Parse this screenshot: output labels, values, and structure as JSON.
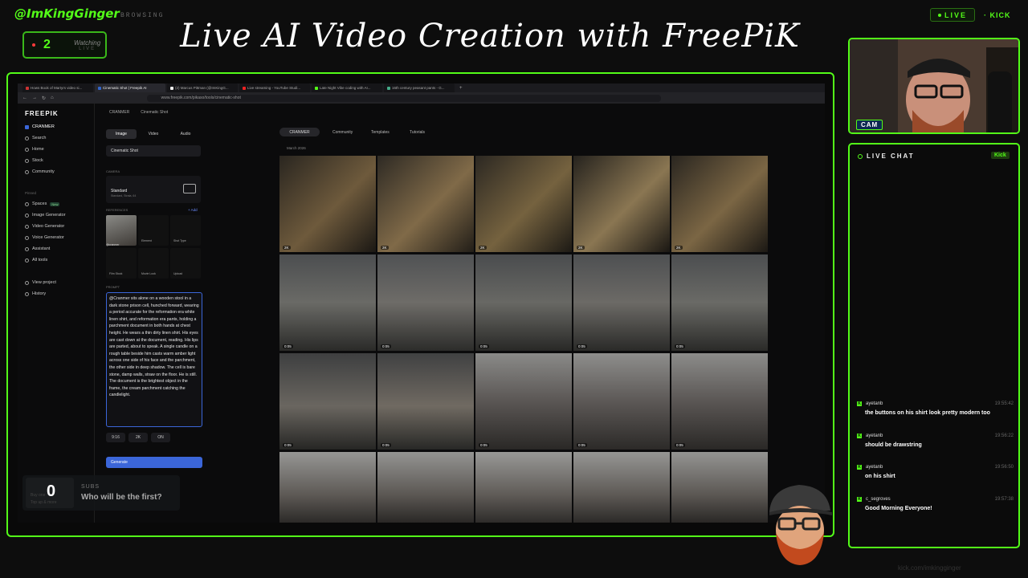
{
  "overlay": {
    "handle": "@ImKingGinger",
    "status": "BROWSING",
    "live_label": "LIVE",
    "platform": "KICK",
    "viewers": "2",
    "viewers_label": "Watching",
    "viewers_sub": "LIVE",
    "title": "Live AI Video Creation with FreePiK",
    "footer_url": "kick.com/imkingginger"
  },
  "browser": {
    "tabs": [
      {
        "label": "Hows Book of Martyrs video si..."
      },
      {
        "label": "Cinematic Shot | Freepik AI"
      },
      {
        "label": "(2) Marcus Pittman (@ImKingG..."
      },
      {
        "label": "Live streaming - YouTube Studi..."
      },
      {
        "label": "Late Night Vibe coding with AI..."
      },
      {
        "label": "16th century peasant pants - G..."
      }
    ],
    "url": "www.freepik.com/pikaso/tools/cinematic-shot"
  },
  "app": {
    "logo": "FREEPIK",
    "workspace": "CRANMER",
    "nav": [
      "Search",
      "Home",
      "Stock",
      "Community"
    ],
    "pinned_label": "Pinned",
    "pinned": [
      "Spaces",
      "Image Generator",
      "Video Generator",
      "Voice Generator",
      "Assistant",
      "All tools"
    ],
    "spaces_badge": "New",
    "bottom_links": [
      "View project",
      "History"
    ],
    "breadcrumb": [
      "CRANMER",
      "Cinematic Shot"
    ],
    "modes": [
      "Image",
      "Video",
      "Audio"
    ],
    "tool": "Cinematic Shot",
    "camera_label": "CAMERA",
    "camera_name": "Standard",
    "camera_detail": "Standard, Strata, 64",
    "references_label": "REFERENCES",
    "add_label": "+ Add",
    "ref_items": [
      "@cranmer",
      "Element",
      "Shot Type",
      "Film Stock",
      "Movie Look",
      "Upload"
    ],
    "prompt_label": "PROMPT",
    "prompt": "@Cranmer sits alone on a wooden stool in a dark stone prison cell, hunched forward, wearing a period accurate for the reformation era white linen shirt, and reformation era pants, holding a parchment document in both hands at chest height. He wears a thin dirty linen shirt. His eyes are cast down at the document, reading. His lips are parted, about to speak. A single candle on a rough table beside him casts warm amber light across one side of his face and the parchment, the other side in deep shadow. The cell is bare stone, damp walls, straw on the floor. He is still. The document is the brightest object in the frame, the cream parchment catching the candlelight.",
    "settings": [
      "9:16",
      "2K",
      "ON"
    ],
    "generate": "Generate",
    "top_pill": "CRANMER",
    "top_links": [
      "Community",
      "Templates",
      "Tutorials"
    ],
    "date_label": "March 2026"
  },
  "gallery": {
    "rows": [
      [
        "2K",
        "2K",
        "2K",
        "2K",
        "2K"
      ],
      [
        "0:05",
        "0:05",
        "0:05",
        "0:05",
        "0:05"
      ],
      [
        "0:05",
        "0:05",
        "0:05",
        "0:05",
        "0:05"
      ],
      [
        "",
        "",
        "",
        "",
        ""
      ]
    ]
  },
  "cam": {
    "label": "CAM"
  },
  "chat": {
    "title": "LIVE CHAT",
    "badge": "Kick",
    "messages": [
      {
        "user": "ayetanb",
        "time": "19:55:42",
        "text": "the buttons on his shirt look pretty modern too"
      },
      {
        "user": "ayetanb",
        "time": "19:56:22",
        "text": "should be drawstring"
      },
      {
        "user": "ayetanb",
        "time": "19:56:50",
        "text": "on his shirt"
      },
      {
        "user": "c_segroves",
        "time": "19:57:38",
        "text": "Good Morning Everyone!"
      }
    ]
  },
  "subs": {
    "count": "0",
    "label": "SUBS",
    "message": "Who will be the first?",
    "small1": "Buy one",
    "small2": "Top up & more"
  },
  "colors": {
    "accent": "#53fc18",
    "generate": "#3b66d9"
  }
}
